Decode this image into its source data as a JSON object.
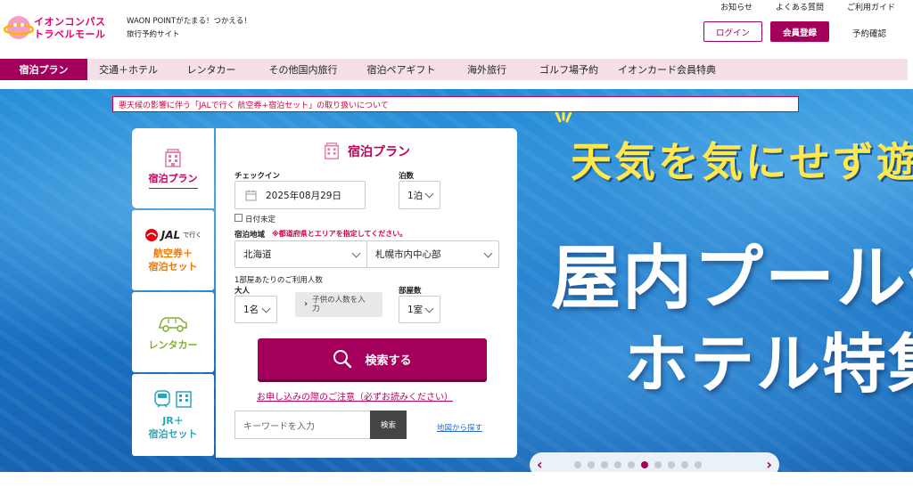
{
  "header": {
    "logo_line1": "イオンコンパス",
    "logo_line2": "トラベルモール",
    "tagline_line1": "WAON POINTがたまる！つかえる！",
    "tagline_line2": "旅行予約サイト",
    "top_links": [
      "お知らせ",
      "よくある質問",
      "ご利用ガイド"
    ],
    "login_label": "ログイン",
    "register_label": "会員登録",
    "reservation_label": "予約確認"
  },
  "nav": {
    "items": [
      "宿泊プラン",
      "交通＋ホテル",
      "レンタカー",
      "その他国内旅行",
      "宿泊ペアギフト",
      "海外旅行",
      "ゴルフ場予約",
      "イオンカード会員特典"
    ]
  },
  "notice": "悪天候の影響に伴う「JALで行く 航空券+宿泊セット」の取り扱いについて",
  "hero": {
    "line1": "天気を気にせず遊",
    "line2": "屋内プール付",
    "line3": "ホテル特集"
  },
  "side_tabs": {
    "stay": "宿泊プラン",
    "jal_logo": "JAL",
    "jal_sub": "で行く",
    "jal_line1": "航空券＋",
    "jal_line2": "宿泊セット",
    "rentacar": "レンタカー",
    "jr_line1": "JR＋",
    "jr_line2": "宿泊セット"
  },
  "form": {
    "title": "宿泊プラン",
    "checkin_label": "チェックイン",
    "checkin_value": "2025年08月29日",
    "nights_label": "泊数",
    "nights_value": "1泊",
    "undecided_label": "日付未定",
    "area_label": "宿泊地域",
    "area_required": "※都道府県とエリアを指定してください。",
    "prefecture_value": "北海道",
    "area_value": "札幌市内中心部",
    "guests_note": "1部屋あたりのご利用人数",
    "adults_label": "大人",
    "adults_value": "1名",
    "child_button_line1": "子供の人数を入",
    "child_button_line2": "力",
    "rooms_label": "部屋数",
    "rooms_value": "1室",
    "search_label": "検索する",
    "caution_link": "お申し込みの際のご注意（必ずお読みください）",
    "keyword_placeholder": "キーワードを入力",
    "keyword_button": "検索",
    "map_link": "地図から探す"
  },
  "carousel": {
    "prev": "‹",
    "next": "›",
    "dot_count": 10,
    "active_index": 5
  },
  "colors": {
    "brand": "#a4005b",
    "accent_red": "#d0004c",
    "jal_orange": "#ee7700",
    "rentacar_green": "#7fae2e",
    "jr_teal": "#2ba6b8"
  }
}
